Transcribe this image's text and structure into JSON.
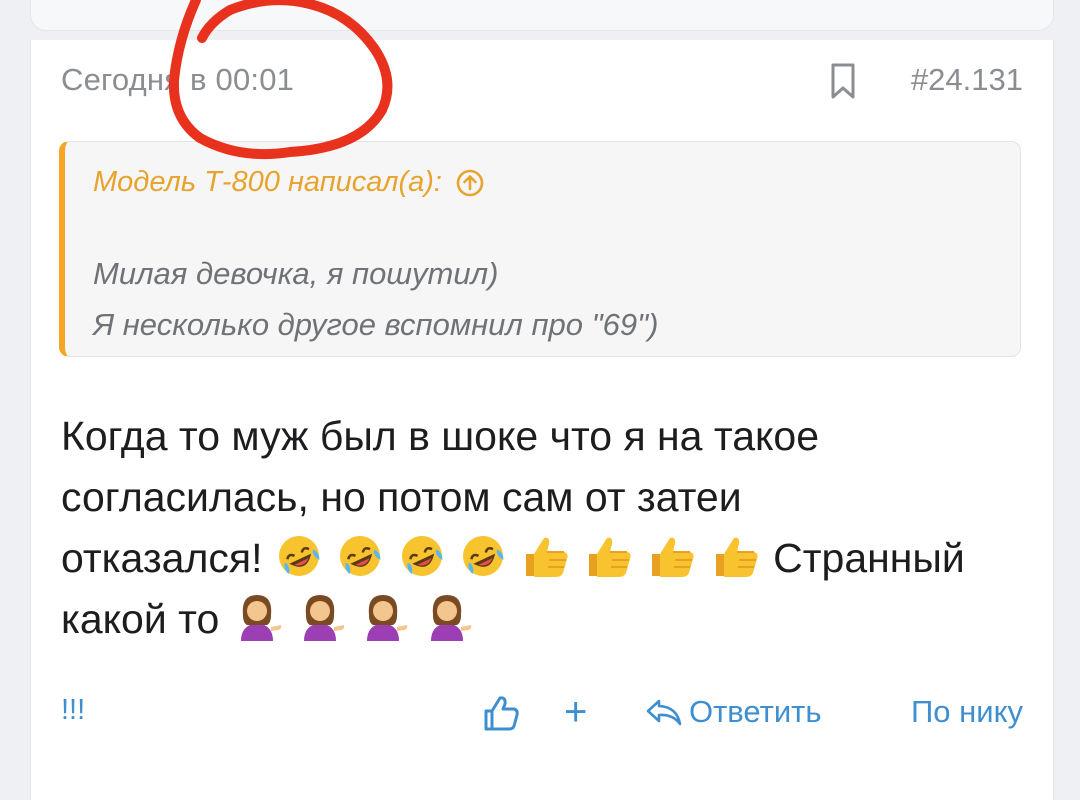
{
  "post": {
    "timestamp": "Сегодня в 00:01",
    "post_number": "#24.131",
    "quote": {
      "author": "Модель Т-800 написал(а):",
      "lines": [
        "Милая девочка, я пошутил)",
        "Я несколько другое вспомнил про \"69\")"
      ]
    },
    "message": {
      "line1": "Когда то муж был в шоке что я на такое",
      "line2": "согласилась, но потом сам от затеи",
      "line3_start": "отказался!",
      "line3_end": " Странный",
      "line4_start": "какой то"
    }
  },
  "footer": {
    "report_label": "!!!",
    "plus_label": "+",
    "reply_label": "Ответить",
    "by_nick_label": "По нику"
  },
  "colors": {
    "accent": "#3f8fd0",
    "quote_border": "#f5a623",
    "quote_author": "#e8a32d",
    "annotation": "#e8321e"
  },
  "icons": [
    "bookmark-icon",
    "arrow-up-circle-icon",
    "thumbs-up-outline-icon",
    "reply-arrow-icon",
    "rolling-laughing-emoji",
    "thumbs-up-emoji",
    "woman-tipping-hand-emoji"
  ]
}
